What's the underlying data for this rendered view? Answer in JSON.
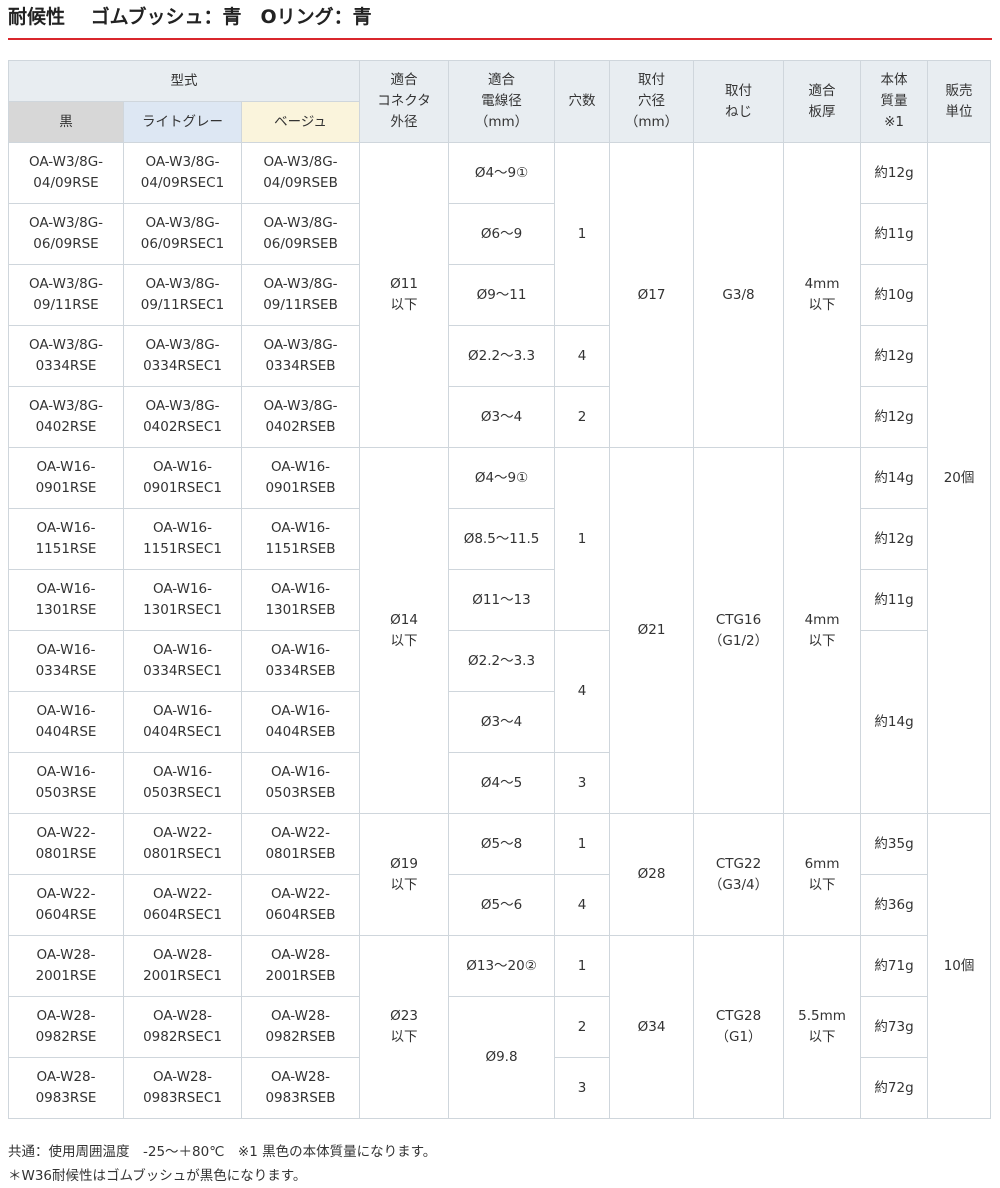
{
  "title": {
    "part1": "耐候性",
    "part2": "ゴムブッシュ：青",
    "part3": "Oリング：青"
  },
  "headers": {
    "model": "型式",
    "black": "黒",
    "lightgray": "ライトグレー",
    "beige": "ベージュ",
    "connector_od": "適合\nコネクタ\n外径",
    "wire_dia": "適合\n電線径\n（mm）",
    "holes": "穴数",
    "mount_hole": "取付\n穴径\n（mm）",
    "thread": "取付\nねじ",
    "thickness": "適合\n板厚",
    "mass": "本体\n質量\n※1",
    "unit": "販売\n単位"
  },
  "rows": [
    {
      "black": "OA-W3/8G-\n04/09RSE",
      "gray": "OA-W3/8G-\n04/09RSEC1",
      "beige": "OA-W3/8G-\n04/09RSEB"
    },
    {
      "black": "OA-W3/8G-\n06/09RSE",
      "gray": "OA-W3/8G-\n06/09RSEC1",
      "beige": "OA-W3/8G-\n06/09RSEB"
    },
    {
      "black": "OA-W3/8G-\n09/11RSE",
      "gray": "OA-W3/8G-\n09/11RSEC1",
      "beige": "OA-W3/8G-\n09/11RSEB"
    },
    {
      "black": "OA-W3/8G-\n0334RSE",
      "gray": "OA-W3/8G-\n0334RSEC1",
      "beige": "OA-W3/8G-\n0334RSEB"
    },
    {
      "black": "OA-W3/8G-\n0402RSE",
      "gray": "OA-W3/8G-\n0402RSEC1",
      "beige": "OA-W3/8G-\n0402RSEB"
    },
    {
      "black": "OA-W16-\n0901RSE",
      "gray": "OA-W16-\n0901RSEC1",
      "beige": "OA-W16-\n0901RSEB"
    },
    {
      "black": "OA-W16-\n1151RSE",
      "gray": "OA-W16-\n1151RSEC1",
      "beige": "OA-W16-\n1151RSEB"
    },
    {
      "black": "OA-W16-\n1301RSE",
      "gray": "OA-W16-\n1301RSEC1",
      "beige": "OA-W16-\n1301RSEB"
    },
    {
      "black": "OA-W16-\n0334RSE",
      "gray": "OA-W16-\n0334RSEC1",
      "beige": "OA-W16-\n0334RSEB"
    },
    {
      "black": "OA-W16-\n0404RSE",
      "gray": "OA-W16-\n0404RSEC1",
      "beige": "OA-W16-\n0404RSEB"
    },
    {
      "black": "OA-W16-\n0503RSE",
      "gray": "OA-W16-\n0503RSEC1",
      "beige": "OA-W16-\n0503RSEB"
    },
    {
      "black": "OA-W22-\n0801RSE",
      "gray": "OA-W22-\n0801RSEC1",
      "beige": "OA-W22-\n0801RSEB"
    },
    {
      "black": "OA-W22-\n0604RSE",
      "gray": "OA-W22-\n0604RSEC1",
      "beige": "OA-W22-\n0604RSEB"
    },
    {
      "black": "OA-W28-\n2001RSE",
      "gray": "OA-W28-\n2001RSEC1",
      "beige": "OA-W28-\n2001RSEB"
    },
    {
      "black": "OA-W28-\n0982RSE",
      "gray": "OA-W28-\n0982RSEC1",
      "beige": "OA-W28-\n0982RSEB"
    },
    {
      "black": "OA-W28-\n0983RSE",
      "gray": "OA-W28-\n0983RSEC1",
      "beige": "OA-W28-\n0983RSEB"
    }
  ],
  "connector_od": [
    "Ø11\n以下",
    "Ø14\n以下",
    "Ø19\n以下",
    "Ø23\n以下"
  ],
  "wire_dia": [
    "Ø4～9①",
    "Ø6～9",
    "Ø9～11",
    "Ø2.2～3.3",
    "Ø3～4",
    "Ø4～9①",
    "Ø8.5～11.5",
    "Ø11～13",
    "Ø2.2～3.3",
    "Ø3～4",
    "Ø4～5",
    "Ø5～8",
    "Ø5～6",
    "Ø13～20②",
    "Ø9.8"
  ],
  "holes": [
    "1",
    "4",
    "2",
    "1",
    "4",
    "3",
    "1",
    "4",
    "1",
    "2",
    "3"
  ],
  "mount_hole": [
    "Ø17",
    "Ø21",
    "Ø28",
    "Ø34"
  ],
  "thread": [
    "G3/8",
    "CTG16\n（G1/2）",
    "CTG22\n（G3/4）",
    "CTG28\n（G1）"
  ],
  "thickness": [
    "4mm\n以下",
    "4mm\n以下",
    "6mm\n以下",
    "5.5mm\n以下"
  ],
  "mass": [
    "約12g",
    "約11g",
    "約10g",
    "約12g",
    "約12g",
    "約14g",
    "約12g",
    "約11g",
    "約14g",
    "約35g",
    "約36g",
    "約71g",
    "約73g",
    "約72g"
  ],
  "unit": [
    "20個",
    "10個"
  ],
  "notes": [
    "共通：使用周囲温度　-25～＋80℃　※1 黒色の本体質量になります。",
    "＊W36耐候性はゴムブッシュが黒色になります。"
  ]
}
